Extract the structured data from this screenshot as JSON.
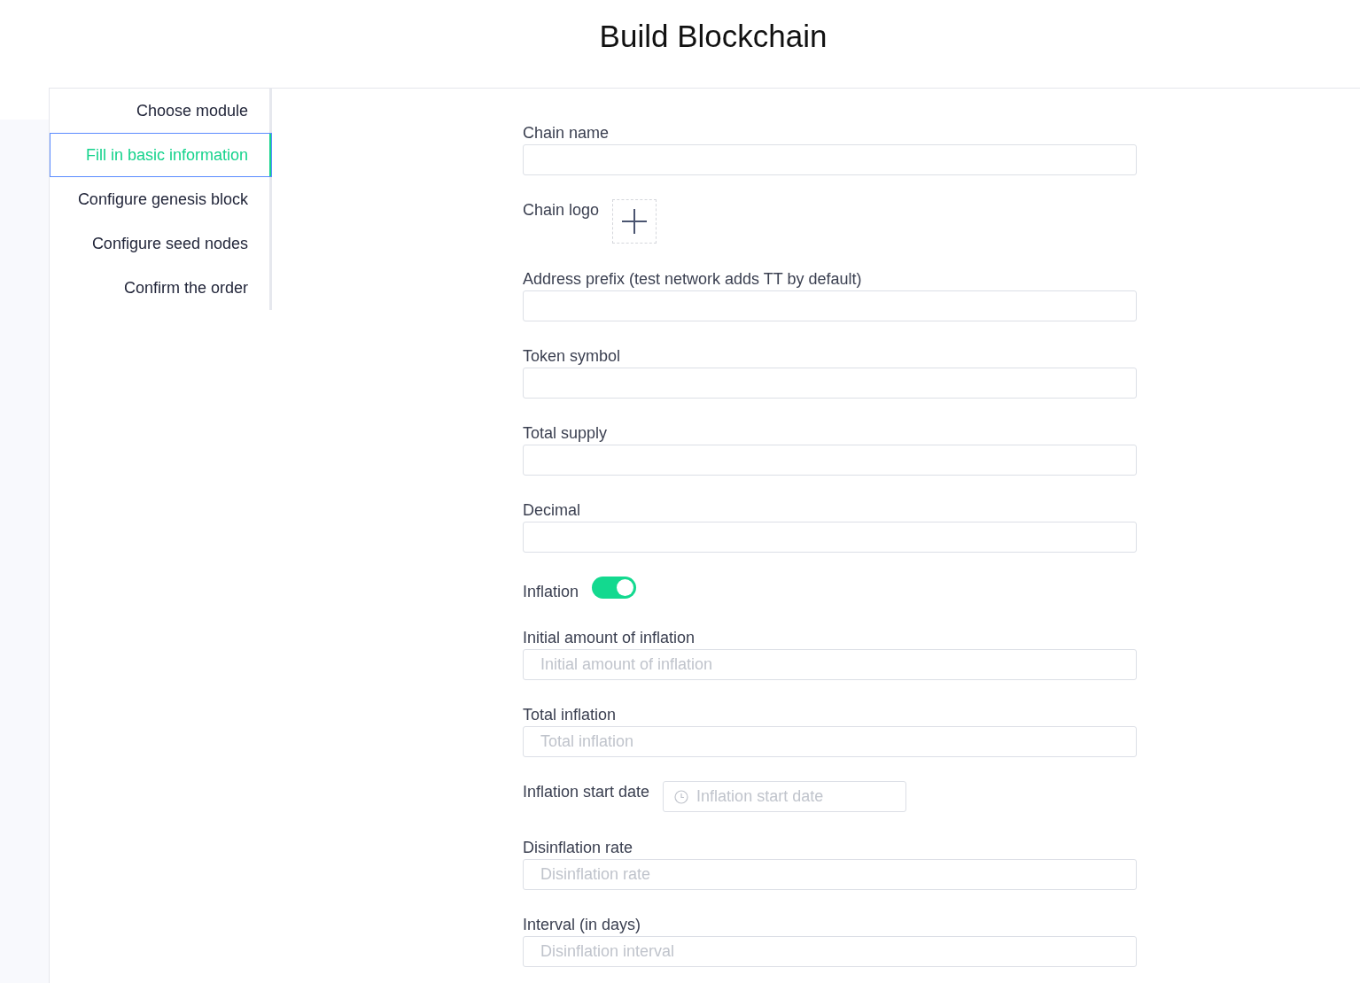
{
  "page": {
    "title": "Build Blockchain"
  },
  "steps": [
    {
      "label": "Choose module",
      "selected": false
    },
    {
      "label": "Fill in basic information",
      "selected": true
    },
    {
      "label": "Configure genesis block",
      "selected": false
    },
    {
      "label": "Configure seed nodes",
      "selected": false
    },
    {
      "label": "Confirm the order",
      "selected": false
    }
  ],
  "form": {
    "fields": [
      {
        "kind": "text",
        "label": "Chain name"
      },
      {
        "kind": "upload",
        "label": "Chain logo"
      },
      {
        "kind": "text",
        "label": "Address prefix (test network adds TT by default)"
      },
      {
        "kind": "text",
        "label": "Token symbol"
      },
      {
        "kind": "text",
        "label": "Total supply"
      },
      {
        "kind": "text",
        "label": "Decimal"
      },
      {
        "kind": "switch",
        "label": "Inflation",
        "on": true
      },
      {
        "kind": "text",
        "label": "Initial amount of inflation",
        "placeholder": "Initial amount of inflation"
      },
      {
        "kind": "text",
        "label": "Total inflation",
        "placeholder": "Total inflation"
      },
      {
        "kind": "date",
        "label": "Inflation start date",
        "placeholder": "Inflation start date"
      },
      {
        "kind": "text",
        "label": "Disinflation rate",
        "placeholder": "Disinflation rate"
      },
      {
        "kind": "text",
        "label": "Interval (in days)",
        "placeholder": "Disinflation interval"
      }
    ]
  }
}
